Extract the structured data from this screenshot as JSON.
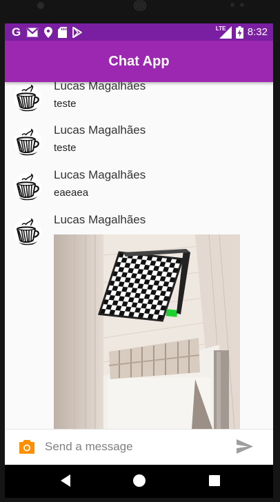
{
  "status_bar": {
    "time": "8:32",
    "left_icons": [
      "google-icon",
      "gmail-icon",
      "location-icon",
      "sd-card-icon",
      "play-store-icon"
    ],
    "right_icons": [
      "lte-signal-icon",
      "battery-charging-icon"
    ],
    "network_label": "LTE"
  },
  "app_bar": {
    "title": "Chat App"
  },
  "messages": [
    {
      "sender": "Lucas Magalhães",
      "text": "teste"
    },
    {
      "sender": "Lucas Magalhães",
      "text": "teste"
    },
    {
      "sender": "Lucas Magalhães",
      "text": "eaeaea"
    },
    {
      "sender": "Lucas Magalhães",
      "image": "photo of a room ceiling with a checkerboard calibration pattern"
    }
  ],
  "composer": {
    "placeholder": "Send a message",
    "value": ""
  },
  "colors": {
    "status_bar": "#7b1fa2",
    "app_bar": "#9c27b0",
    "camera_icon": "#ff8f00",
    "send_icon": "#9e9e9e"
  },
  "nav_bar": {
    "buttons": [
      "back-icon",
      "home-icon",
      "recents-icon"
    ]
  }
}
